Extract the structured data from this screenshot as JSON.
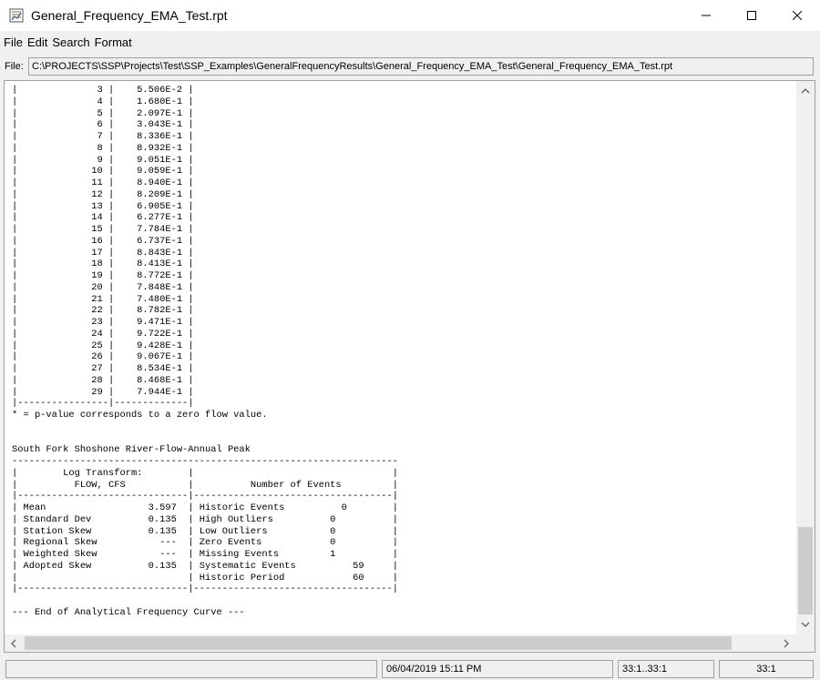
{
  "window": {
    "title": "General_Frequency_EMA_Test.rpt",
    "minimize_glyph": "—",
    "icons": {
      "app": "report-icon",
      "minimize": "minimize-icon",
      "maximize": "maximize-icon",
      "close": "close-icon"
    }
  },
  "menu": {
    "items": [
      "File",
      "Edit",
      "Search",
      "Format"
    ]
  },
  "file": {
    "label": "File:",
    "path": "C:\\PROJECTS\\SSP\\Projects\\Test\\SSP_Examples\\GeneralFrequencyResults\\General_Frequency_EMA_Test\\General_Frequency_EMA_Test.rpt"
  },
  "report": {
    "lines": [
      "|              3 |    5.506E-2 |",
      "|              4 |    1.680E-1 |",
      "|              5 |    2.097E-1 |",
      "|              6 |    3.043E-1 |",
      "|              7 |    8.336E-1 |",
      "|              8 |    8.932E-1 |",
      "|              9 |    9.051E-1 |",
      "|             10 |    9.059E-1 |",
      "|             11 |    8.940E-1 |",
      "|             12 |    8.209E-1 |",
      "|             13 |    6.905E-1 |",
      "|             14 |    6.277E-1 |",
      "|             15 |    7.784E-1 |",
      "|             16 |    6.737E-1 |",
      "|             17 |    8.843E-1 |",
      "|             18 |    8.413E-1 |",
      "|             19 |    8.772E-1 |",
      "|             20 |    7.848E-1 |",
      "|             21 |    7.480E-1 |",
      "|             22 |    8.782E-1 |",
      "|             23 |    9.471E-1 |",
      "|             24 |    9.722E-1 |",
      "|             25 |    9.428E-1 |",
      "|             26 |    9.067E-1 |",
      "|             27 |    8.534E-1 |",
      "|             28 |    8.468E-1 |",
      "|             29 |    7.944E-1 |",
      "|----------------|-------------|",
      "* = p-value corresponds to a zero flow value.",
      "",
      "",
      "South Fork Shoshone River-Flow-Annual Peak",
      "--------------------------------------------------------------------",
      "|        Log Transform:        |                                   |",
      "|          FLOW, CFS           |          Number of Events         |",
      "|------------------------------|-----------------------------------|",
      "| Mean                  3.597  | Historic Events          0        |",
      "| Standard Dev          0.135  | High Outliers          0          |",
      "| Station Skew          0.135  | Low Outliers           0          |",
      "| Regional Skew           ---  | Zero Events            0          |",
      "| Weighted Skew           ---  | Missing Events         1          |",
      "| Adopted Skew          0.135  | Systematic Events          59     |",
      "|                              | Historic Period            60     |",
      "|------------------------------|-----------------------------------|",
      "",
      "--- End of Analytical Frequency Curve ---"
    ]
  },
  "scrollbar": {
    "up_icon": "chevron-up-icon",
    "down_icon": "chevron-down-icon",
    "left_icon": "chevron-left-icon",
    "right_icon": "chevron-right-icon"
  },
  "status": {
    "cell1": "",
    "timestamp": "06/04/2019 15:11 PM",
    "selection": "33:1..33:1",
    "position": "33:1"
  }
}
